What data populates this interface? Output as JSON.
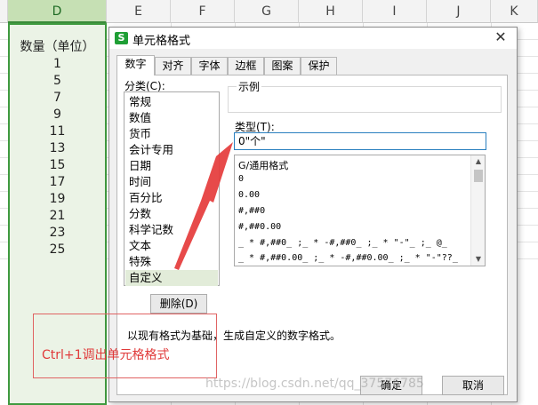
{
  "spreadsheet": {
    "columns": [
      "D",
      "E",
      "F",
      "G",
      "H",
      "I",
      "J",
      "K"
    ],
    "selected_column": "D",
    "column_d_cells": [
      "数量（单位）",
      "1",
      "5",
      "7",
      "9",
      "11",
      "13",
      "15",
      "17",
      "19",
      "21",
      "23",
      "25"
    ]
  },
  "dialog": {
    "title": "单元格格式",
    "app_icon": "S",
    "close_glyph": "✕",
    "tabs": [
      "数字",
      "对齐",
      "字体",
      "边框",
      "图案",
      "保护"
    ],
    "active_tab": "数字",
    "category_label": "分类(C):",
    "categories": [
      "常规",
      "数值",
      "货币",
      "会计专用",
      "日期",
      "时间",
      "百分比",
      "分数",
      "科学记数",
      "文本",
      "特殊",
      "自定义"
    ],
    "selected_category": "自定义",
    "sample_label": "示例",
    "type_label": "类型(T):",
    "type_value": "0\"个\"",
    "formats": [
      "G/通用格式",
      "0",
      "0.00",
      "#,##0",
      "#,##0.00",
      "_ * #,##0_ ;_ * -#,##0_ ;_ * \"-\"_ ;_ @_",
      "_ * #,##0.00_ ;_ * -#,##0.00_ ;_ * \"-\"??_"
    ],
    "delete_button": "删除(D)",
    "description": "以现有格式为基础，生成自定义的数字格式。",
    "ok_button": "确定",
    "cancel_button": "取消"
  },
  "annotation": {
    "text": "Ctrl+1调出单元格格式",
    "color": "#e03a3a"
  },
  "watermark": "https://blog.csdn.net/qq_37576785"
}
